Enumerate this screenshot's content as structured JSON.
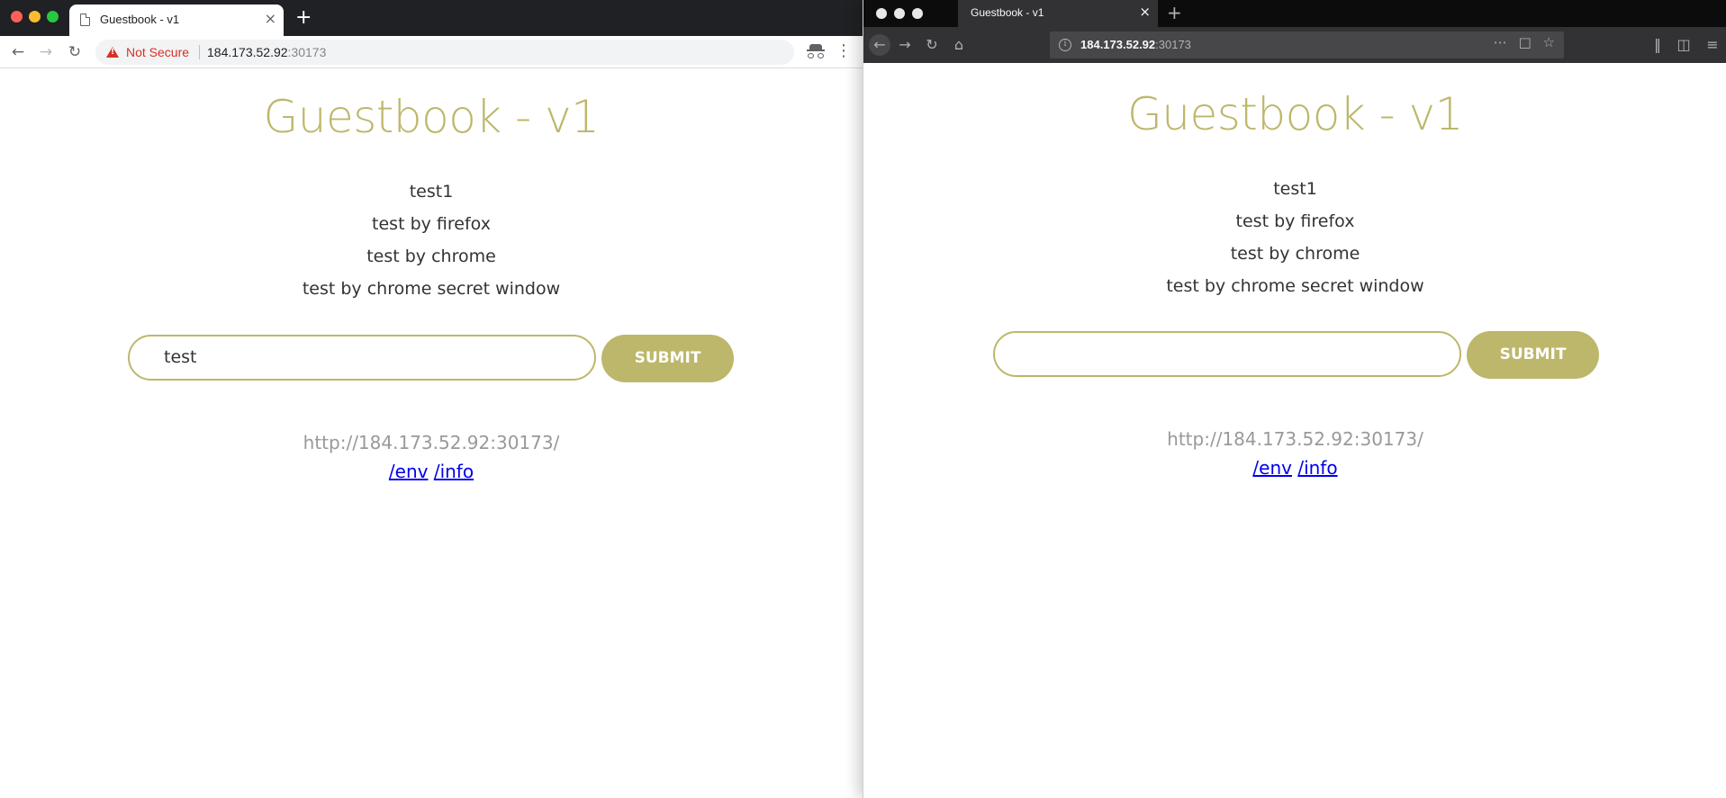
{
  "chrome": {
    "tab_title": "Guestbook - v1",
    "tab_close": "×",
    "new_tab": "+",
    "not_secure": "Not Secure",
    "url_host": "184.173.52.92",
    "url_port": ":30173",
    "icons": [
      "back-icon",
      "forward-icon",
      "reload-icon",
      "warning-icon",
      "star-icon",
      "incognito-icon",
      "menu-icon"
    ]
  },
  "firefox": {
    "tab_title": "Guestbook - v1",
    "tab_close": "×",
    "new_tab": "+",
    "url_host": "184.173.52.92",
    "url_port": ":30173",
    "icons": [
      "back-icon",
      "forward-icon",
      "reload-icon",
      "home-icon",
      "info-icon",
      "page-actions-icon",
      "pocket-icon",
      "bookmark-star-icon",
      "library-icon",
      "sidebar-icon",
      "hamburger-menu-icon"
    ]
  },
  "page": {
    "title": "Guestbook - v1",
    "entries": [
      "test1",
      "test by firefox",
      "test by chrome",
      "test by chrome secret window"
    ],
    "submit_label": "SUBMIT",
    "host_text": "http://184.173.52.92:30173/",
    "link_env": "/env",
    "link_info": "/info"
  },
  "left_input_value": "test",
  "right_input_value": "",
  "colors": {
    "accent": "#bdb76b",
    "entry_text": "#333333",
    "host_text": "#999999",
    "link": "#0000ee",
    "not_secure": "#d93025",
    "chrome_frame": "#202124",
    "firefox_frame": "#0c0c0d",
    "firefox_toolbar": "#323234"
  }
}
